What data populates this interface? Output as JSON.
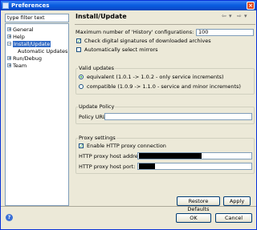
{
  "window": {
    "title": "Preferences",
    "close_glyph": "×"
  },
  "filter": {
    "value": "type filter text"
  },
  "tree": {
    "items": [
      {
        "label": "General",
        "expander": "+"
      },
      {
        "label": "Help",
        "expander": "+"
      },
      {
        "label": "Install/Update",
        "expander": "−"
      },
      {
        "label": "Automatic Updates"
      },
      {
        "label": "Run/Debug",
        "expander": "+"
      },
      {
        "label": "Team",
        "expander": "+"
      }
    ]
  },
  "page": {
    "title": "Install/Update",
    "nav": {
      "back": "⇦",
      "back_menu": "▾",
      "forward": "⇨",
      "forward_menu": "▾"
    },
    "max_history_label": "Maximum number of 'History' configurations:",
    "max_history_value": "100",
    "check_signatures_label": "Check digital signatures of downloaded archives",
    "check_signatures_checked": true,
    "auto_mirrors_label": "Automatically select mirrors",
    "auto_mirrors_checked": false
  },
  "valid_updates": {
    "title": "Valid updates",
    "options": [
      {
        "label": "equivalent (1.0.1 -> 1.0.2 - only service increments)",
        "selected": true
      },
      {
        "label": "compatible (1.0.9 -> 1.1.0 - service and minor increments)",
        "selected": false
      }
    ]
  },
  "update_policy": {
    "title": "Update Policy",
    "url_label": "Policy URL:",
    "url_value": ""
  },
  "proxy": {
    "title": "Proxy settings",
    "enable_label": "Enable HTTP proxy connection",
    "enable_checked": true,
    "address_label": "HTTP proxy host address:",
    "port_label": "HTTP proxy host port:"
  },
  "buttons": {
    "restore": "Restore Defaults",
    "apply": "Apply",
    "ok": "OK",
    "cancel": "Cancel"
  },
  "icons": {
    "help": "?",
    "check": "✓"
  },
  "colors": {
    "title_bar": "#0a5de0",
    "selection": "#316ac5",
    "window_bg": "#ece9d8"
  }
}
